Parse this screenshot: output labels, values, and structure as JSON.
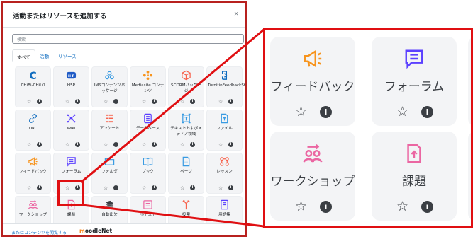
{
  "dialog": {
    "title": "活動またはリソースを追加する",
    "close_label": "×",
    "search_placeholder": "検索",
    "tabs": [
      {
        "label": "すべて",
        "active": true
      },
      {
        "label": "活動",
        "active": false
      },
      {
        "label": "リソース",
        "active": false
      }
    ],
    "items": [
      {
        "label": "CHiBi-CHiLO",
        "icon": "chibichilo-icon",
        "color": "#0f6cbf"
      },
      {
        "label": "H5P",
        "icon": "h5p-icon",
        "color": "#1f5bc6"
      },
      {
        "label": "IMSコンテンツパッケージ",
        "icon": "ims-package-icon",
        "color": "#399be2"
      },
      {
        "label": "Mediasite コンテンツ",
        "icon": "mediasite-icon",
        "color": "#f7941d"
      },
      {
        "label": "SCORMパッケージ",
        "icon": "scorm-icon",
        "color": "#f7634d"
      },
      {
        "label": "TurnitinFeedbackStudio",
        "icon": "turnitin-icon",
        "color": "#0f6cbf"
      },
      {
        "label": "URL",
        "icon": "link-icon",
        "color": "#0f6cbf"
      },
      {
        "label": "Wiki",
        "icon": "wiki-icon",
        "color": "#5b40ff"
      },
      {
        "label": "アンケート",
        "icon": "survey-icon",
        "color": "#f7634d"
      },
      {
        "label": "データベース",
        "icon": "database-icon",
        "color": "#5b40ff"
      },
      {
        "label": "テキストおよびメディア領域",
        "icon": "text-media-icon",
        "color": "#399be2"
      },
      {
        "label": "ファイル",
        "icon": "file-icon",
        "color": "#399be2"
      },
      {
        "label": "フィードバック",
        "icon": "feedback-icon",
        "color": "#f7941d"
      },
      {
        "label": "フォーラム",
        "icon": "forum-icon",
        "color": "#5b40ff"
      },
      {
        "label": "フォルダ",
        "icon": "folder-icon",
        "color": "#399be2"
      },
      {
        "label": "ブック",
        "icon": "book-icon",
        "color": "#399be2"
      },
      {
        "label": "ページ",
        "icon": "page-icon",
        "color": "#399be2"
      },
      {
        "label": "レッスン",
        "icon": "lesson-icon",
        "color": "#f7634d"
      },
      {
        "label": "ワークショップ",
        "icon": "workshop-icon",
        "color": "#eb66a2"
      },
      {
        "label": "課題",
        "icon": "assignment-icon",
        "color": "#eb66a2"
      },
      {
        "label": "自動出欠",
        "icon": "attendance-icon",
        "color": "#3b3f44"
      },
      {
        "label": "小テスト",
        "icon": "quiz-icon",
        "color": "#eb66a2"
      },
      {
        "label": "投票",
        "icon": "choice-icon",
        "color": "#f7634d"
      },
      {
        "label": "用語集",
        "icon": "glossary-icon",
        "color": "#5b40ff"
      }
    ],
    "footer_text": "またはコンテンツを閲覧する",
    "footer_logo_prefix": "m",
    "footer_logo_rest": "oodleNet"
  },
  "zoom": {
    "items": [
      {
        "label": "フィードバック",
        "icon": "feedback-icon",
        "color": "#f7941d"
      },
      {
        "label": "フォーラム",
        "icon": "forum-icon",
        "color": "#5b40ff"
      },
      {
        "label": "ワークショップ",
        "icon": "workshop-icon",
        "color": "#eb66a2"
      },
      {
        "label": "課題",
        "icon": "assignment-icon",
        "color": "#eb66a2"
      }
    ]
  },
  "colors": {
    "highlight": "#e00f12",
    "dialog_border": "#b8211f",
    "link": "#0f6cbf"
  }
}
